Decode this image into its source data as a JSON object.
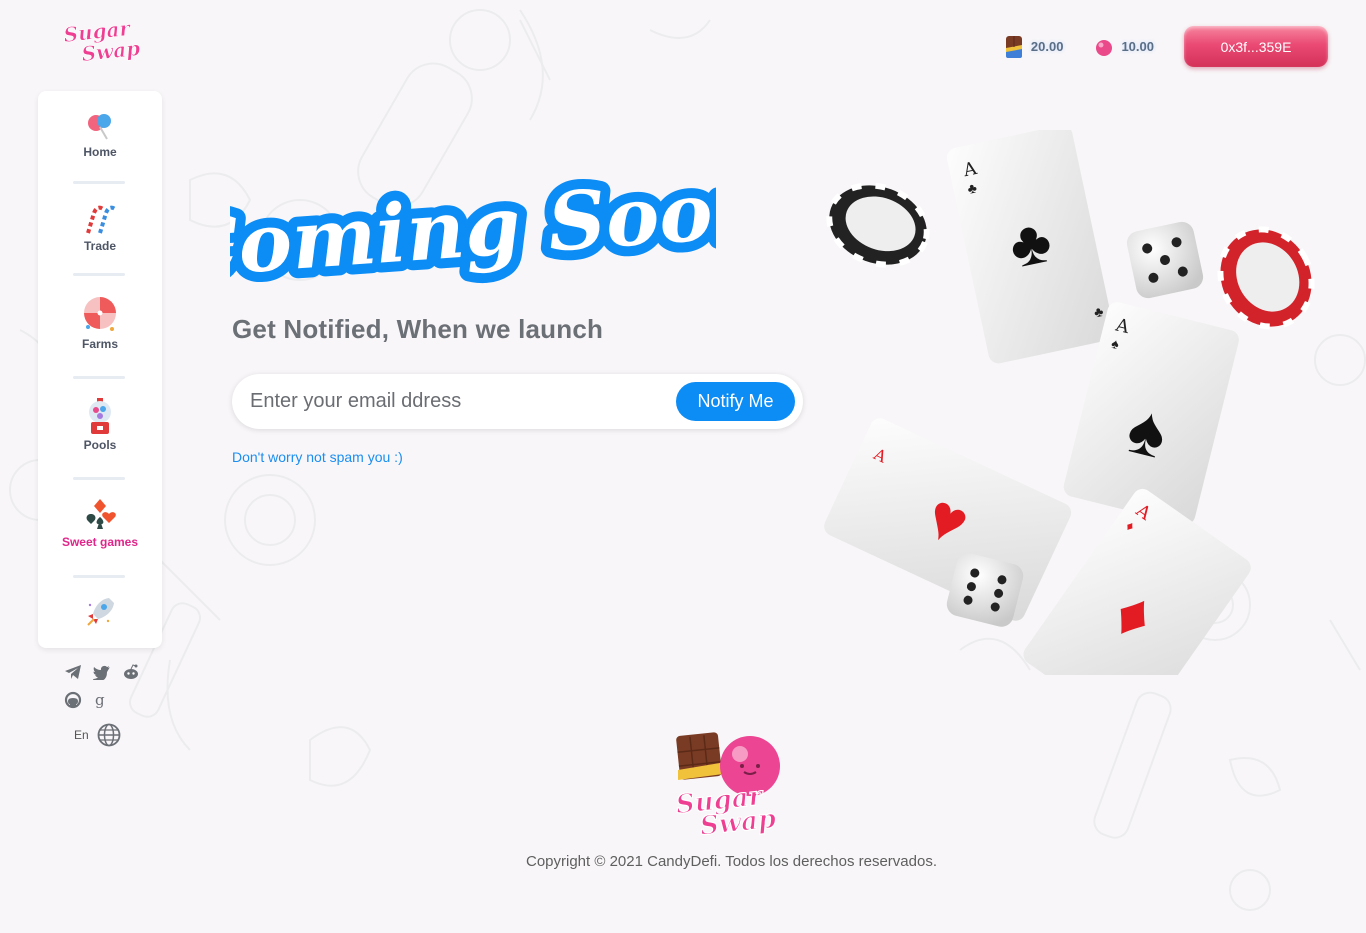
{
  "app": {
    "name": "SugarSwap"
  },
  "logo": {
    "line1": "Sugar",
    "line2": "Swap"
  },
  "balances": [
    {
      "icon": "chocolate-icon",
      "value": "20.00"
    },
    {
      "icon": "candy-icon",
      "value": "10.00"
    }
  ],
  "wallet": {
    "address": "0x3f...359E"
  },
  "sidebar": {
    "items": [
      {
        "label": "Home",
        "icon": "lollipop-icon"
      },
      {
        "label": "Trade",
        "icon": "candy-cane-icon"
      },
      {
        "label": "Farms",
        "icon": "pinwheel-icon"
      },
      {
        "label": "Pools",
        "icon": "gumball-machine-icon"
      },
      {
        "label": "Sweet games",
        "icon": "card-suits-icon",
        "active": true
      },
      {
        "label": "",
        "icon": "rocket-icon"
      }
    ]
  },
  "social": [
    "telegram-icon",
    "twitter-icon",
    "reddit-icon",
    "github-icon",
    "gitbook-icon"
  ],
  "language": {
    "code": "En"
  },
  "hero": {
    "title": "Coming Soon",
    "subtitle": "Get Notified, When we launch",
    "email_placeholder": "Enter your email ddress",
    "notify_label": "Notify Me",
    "note": "Don't worry not spam you :)"
  },
  "footer": {
    "copyright": "Copyright © 2021 CandyDefi. Todos los derechos reservados."
  },
  "colors": {
    "accent_blue": "#0c8cf5",
    "brand_pink": "#e0268a",
    "wallet_pink": "#ea4a74"
  }
}
